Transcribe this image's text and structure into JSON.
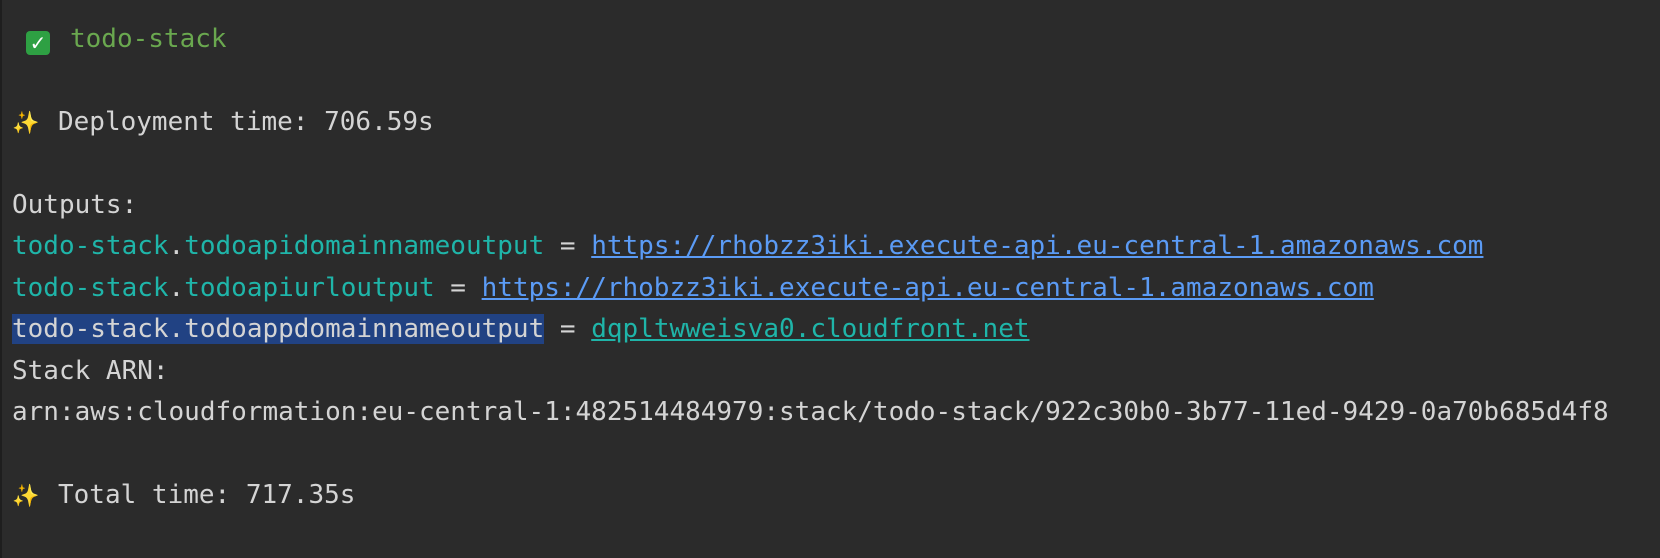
{
  "stack_line": {
    "check_glyph": "✓",
    "name": "todo-stack"
  },
  "deployment": {
    "sparkle_glyph": "✨",
    "label": "Deployment time: 706.59s"
  },
  "outputs": {
    "header": "Outputs:",
    "items": [
      {
        "stack": "todo-stack",
        "dot": ".",
        "key": "todoapidomainnameoutput",
        "eq": " = ",
        "value": "https://rhobzz3iki.execute-api.eu-central-1.amazonaws.com"
      },
      {
        "stack": "todo-stack",
        "dot": ".",
        "key": "todoapiurloutput",
        "eq": " = ",
        "value": "https://rhobzz3iki.execute-api.eu-central-1.amazonaws.com"
      },
      {
        "stack": "todo-stack",
        "dot": ".",
        "key": "todoappdomainnameoutput",
        "eq": " = ",
        "value": "dqpltwweisva0.cloudfront.net"
      }
    ]
  },
  "stack_arn": {
    "label": "Stack ARN:",
    "value": "arn:aws:cloudformation:eu-central-1:482514484979:stack/todo-stack/922c30b0-3b77-11ed-9429-0a70b685d4f8"
  },
  "total": {
    "sparkle_glyph": "✨",
    "label": "Total time: 717.35s"
  },
  "colors": {
    "background": "#2b2b2b",
    "text": "#d4d4d4",
    "stack_green": "#6aa84f",
    "output_teal": "#1fb5a9",
    "link_blue": "#5b9bf5",
    "selection": "#214283",
    "check_green": "#2ea043",
    "sparkle_yellow": "#f2c94c"
  }
}
